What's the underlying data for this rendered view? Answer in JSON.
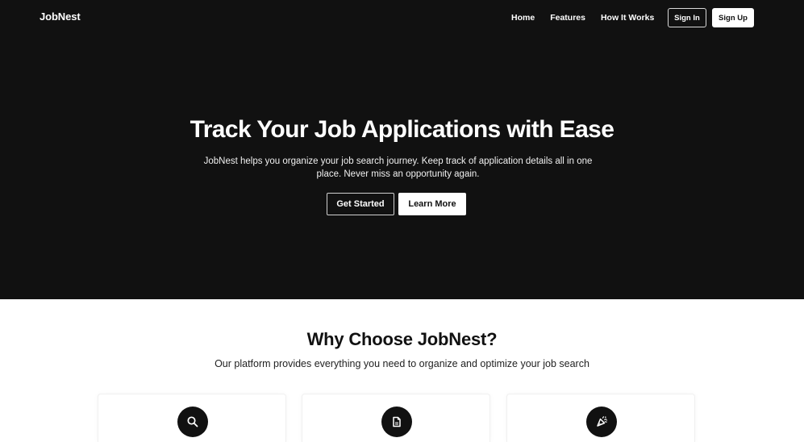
{
  "nav": {
    "logo": "JobNest",
    "links": [
      "Home",
      "Features",
      "How It Works"
    ],
    "signin_label": "Sign In",
    "signup_label": "Sign Up"
  },
  "hero": {
    "title": "Track Your Job Applications with Ease",
    "subtitle": "JobNest helps you organize your job search journey. Keep track of application details all in one place. Never miss an opportunity again.",
    "get_started_label": "Get Started",
    "learn_more_label": "Learn More",
    "background": "#111111"
  },
  "features": {
    "title": "Why Choose JobNest?",
    "subtitle": "Our platform provides everything you need to organize and optimize your job search",
    "cards": [
      {
        "icon": "search-icon"
      },
      {
        "icon": "document-icon"
      },
      {
        "icon": "party-popper-icon"
      }
    ]
  }
}
